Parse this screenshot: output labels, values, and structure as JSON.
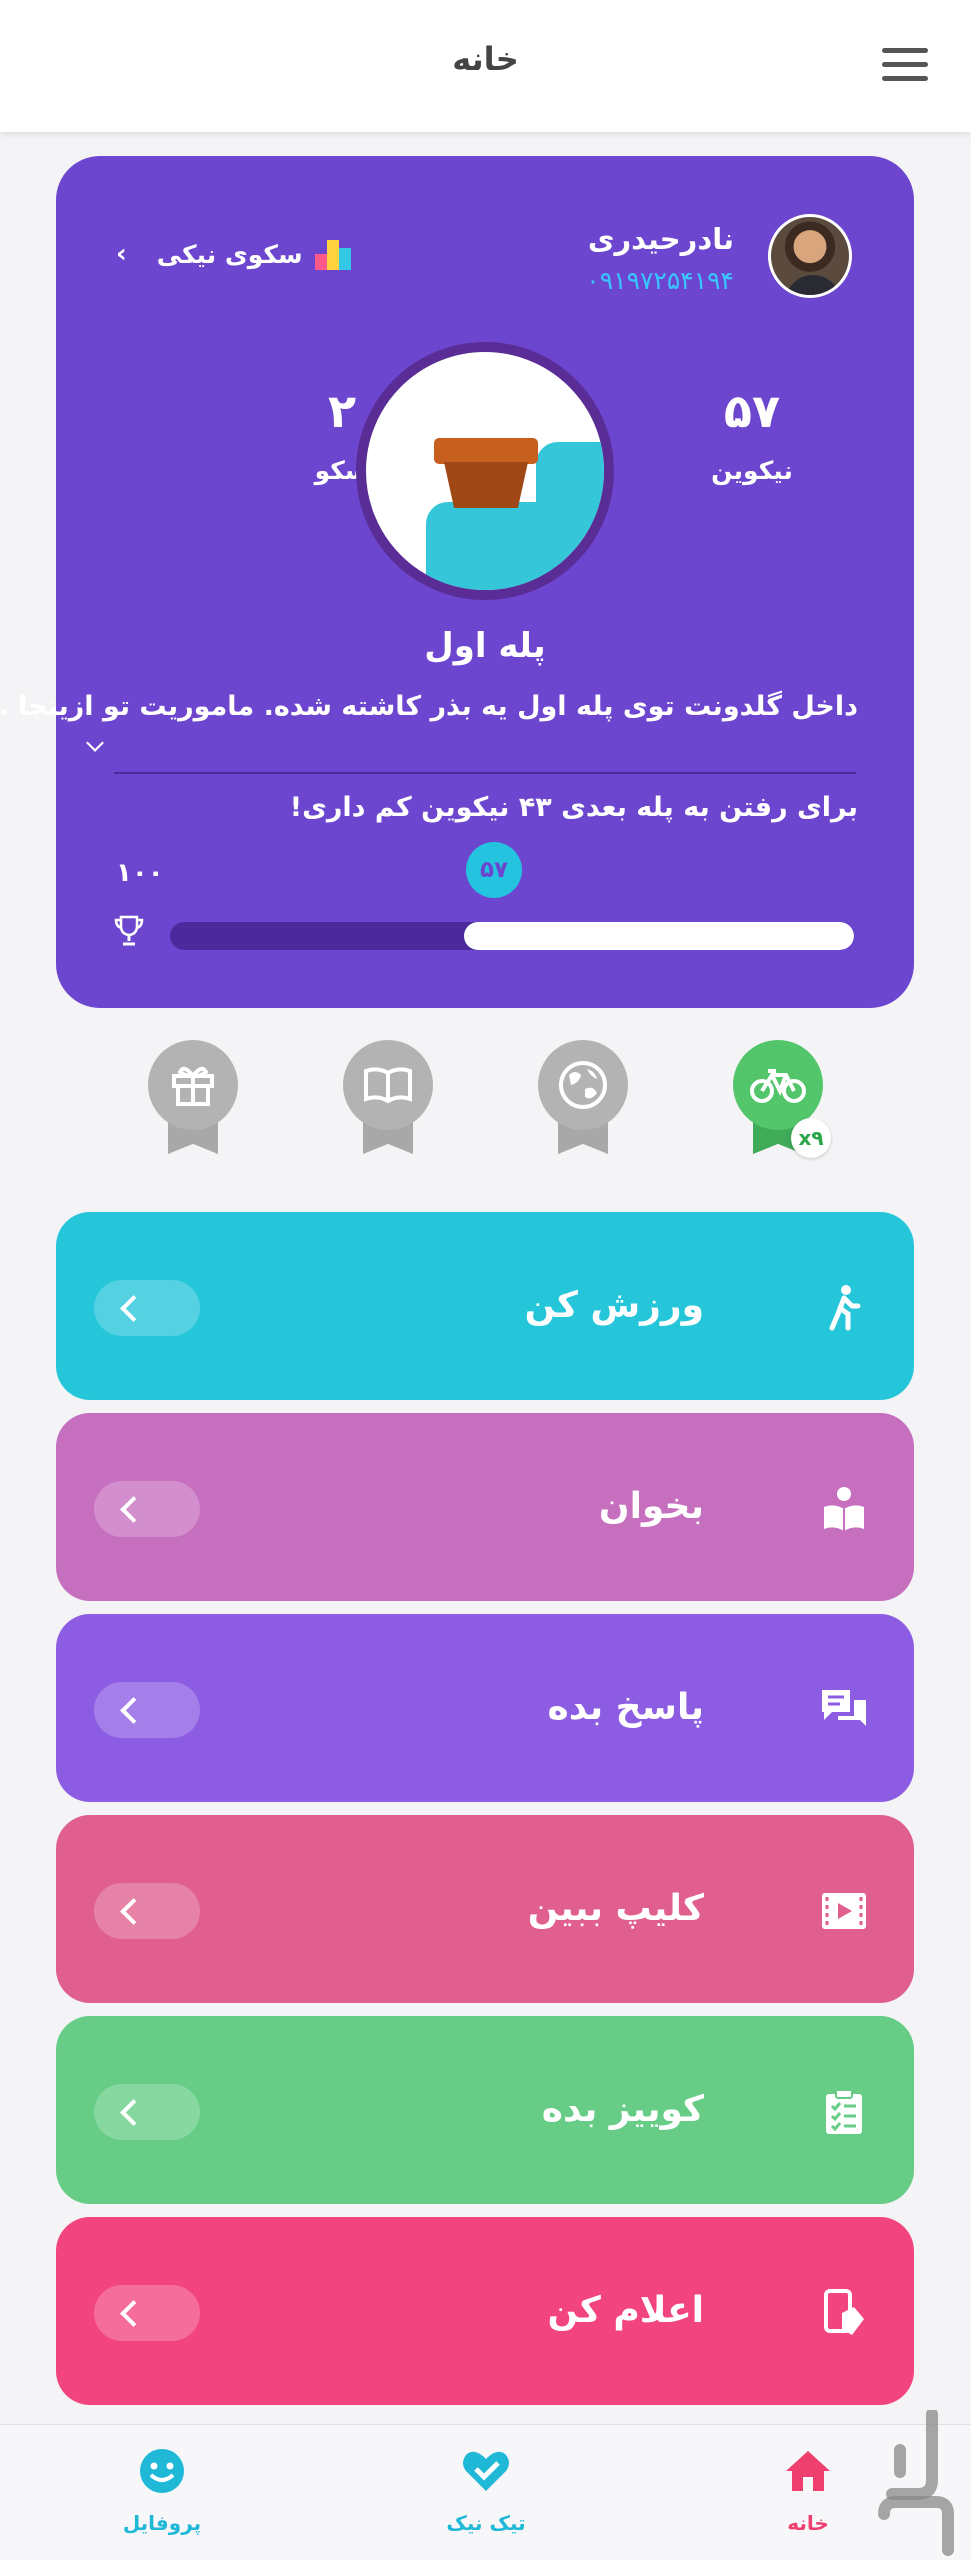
{
  "header": {
    "title": "خانه"
  },
  "user": {
    "name": "نادرحیدری",
    "phone": "۰۹۱۹۷۲۵۴۱۹۴"
  },
  "leaderboard": {
    "label": "سکوی نیکی"
  },
  "stats": {
    "coins_value": "۵۷",
    "coins_label": "نیکوین",
    "podium_value": "۲",
    "podium_label": "سکو"
  },
  "stage": {
    "title": "پله اول",
    "description": "داخل گلدونت توی پله اول یه بذر کاشته شده. ماموریت تو ازینجا ...",
    "next_message": "برای رفتن به پله بعدی ۴۳ نیکوین کم داری!",
    "progress_current": "۵۷",
    "progress_max": "۱۰۰",
    "progress_fraction": 0.57
  },
  "badges": [
    {
      "icon": "bicycle-icon",
      "active": true,
      "multiplier": "x۹"
    },
    {
      "icon": "globe-icon",
      "active": false
    },
    {
      "icon": "book-icon",
      "active": false
    },
    {
      "icon": "gift-icon",
      "active": false
    }
  ],
  "actions": [
    {
      "label": "ورزش کن",
      "icon": "walking-person-icon",
      "color": "#26c6da"
    },
    {
      "label": "بخوان",
      "icon": "reading-person-icon",
      "color": "#c66fbf"
    },
    {
      "label": "پاسخ بده",
      "icon": "chat-answer-icon",
      "color": "#8c5ce3"
    },
    {
      "label": "کلیپ ببین",
      "icon": "video-clip-icon",
      "color": "#e05f8f"
    },
    {
      "label": "کوییز بده",
      "icon": "quiz-clipboard-icon",
      "color": "#66cc86"
    },
    {
      "label": "اعلام کن",
      "icon": "phone-announce-icon",
      "color": "#f2457f"
    }
  ],
  "bottom_nav": {
    "home": "خانه",
    "tick": "تیک نیک",
    "profile": "پروفایل"
  },
  "colors": {
    "hero_bg": "#6d46cf",
    "accent_cyan": "#24c3e0",
    "home_active": "#ef3f6f",
    "nav_cyan": "#1fb8d6"
  }
}
